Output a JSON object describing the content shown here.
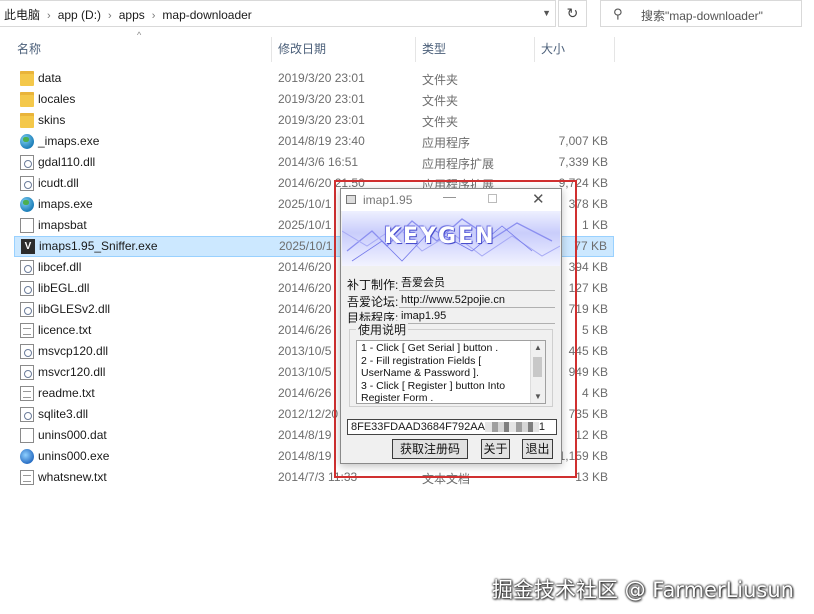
{
  "address_bar": {
    "crumbs": [
      "此电脑",
      "app (D:)",
      "apps",
      "map-downloader"
    ],
    "search_placeholder": "搜索\"map-downloader\""
  },
  "columns": {
    "name": "名称",
    "modified": "修改日期",
    "type": "类型",
    "size": "大小"
  },
  "files": [
    {
      "icon": "folder-icon",
      "name": "data",
      "date": "2019/3/20 23:01",
      "type": "文件夹",
      "size": ""
    },
    {
      "icon": "folder-icon",
      "name": "locales",
      "date": "2019/3/20 23:01",
      "type": "文件夹",
      "size": ""
    },
    {
      "icon": "folder-icon",
      "name": "skins",
      "date": "2019/3/20 23:01",
      "type": "文件夹",
      "size": ""
    },
    {
      "icon": "globe-app-icon",
      "name": "_imaps.exe",
      "date": "2014/8/19 23:40",
      "type": "应用程序",
      "size": "7,007 KB"
    },
    {
      "icon": "dll-file-icon",
      "name": "gdal110.dll",
      "date": "2014/3/6 16:51",
      "type": "应用程序扩展",
      "size": "7,339 KB"
    },
    {
      "icon": "dll-file-icon",
      "name": "icudt.dll",
      "date": "2014/6/20 21:50",
      "type": "应用程序扩展",
      "size": "9,724 KB"
    },
    {
      "icon": "globe-app-icon",
      "name": "imaps.exe",
      "date": "2025/10/1",
      "type": "",
      "size": "378 KB"
    },
    {
      "icon": "blank-file-icon",
      "name": "imapsbat",
      "date": "2025/10/1",
      "type": "",
      "size": "1 KB"
    },
    {
      "icon": "v-app-icon",
      "name": "imaps1.95_Sniffer.exe",
      "date": "2025/10/1",
      "type": "",
      "size": "77 KB"
    },
    {
      "icon": "dll-file-icon",
      "name": "libcef.dll",
      "date": "2014/6/20",
      "type": "",
      "size": "394 KB"
    },
    {
      "icon": "dll-file-icon",
      "name": "libEGL.dll",
      "date": "2014/6/20",
      "type": "",
      "size": "127 KB"
    },
    {
      "icon": "dll-file-icon",
      "name": "libGLESv2.dll",
      "date": "2014/6/20",
      "type": "",
      "size": "719 KB"
    },
    {
      "icon": "text-file-icon",
      "name": "licence.txt",
      "date": "2014/6/26",
      "type": "",
      "size": "5 KB"
    },
    {
      "icon": "dll-file-icon",
      "name": "msvcp120.dll",
      "date": "2013/10/5",
      "type": "",
      "size": "445 KB"
    },
    {
      "icon": "dll-file-icon",
      "name": "msvcr120.dll",
      "date": "2013/10/5",
      "type": "",
      "size": "949 KB"
    },
    {
      "icon": "text-file-icon",
      "name": "readme.txt",
      "date": "2014/6/26",
      "type": "",
      "size": "4 KB"
    },
    {
      "icon": "dll-file-icon",
      "name": "sqlite3.dll",
      "date": "2012/12/20",
      "type": "",
      "size": "735 KB"
    },
    {
      "icon": "blank-file-icon",
      "name": "unins000.dat",
      "date": "2014/8/19",
      "type": "",
      "size": "12 KB"
    },
    {
      "icon": "setup-app-icon",
      "name": "unins000.exe",
      "date": "2014/8/19",
      "type": "",
      "size": "1,159 KB"
    },
    {
      "icon": "text-file-icon",
      "name": "whatsnew.txt",
      "date": "2014/7/3 11:33",
      "type": "文本文档",
      "size": "13 KB"
    }
  ],
  "selected_index": 8,
  "keygen": {
    "title": "imap1.95",
    "banner": "KEYGEN",
    "labels": {
      "patcher": "补丁制作:",
      "forum": "吾爱论坛:",
      "target": "目标程序:"
    },
    "values": {
      "patcher": "吾爱会员",
      "forum": "http://www.52pojie.cn",
      "target": "imap1.95"
    },
    "instructions_title": "使用说明",
    "instructions": [
      "1 - Click [ Get Serial ] button .",
      "2 - Fill registration Fields [",
      "UserName & Password ].",
      "3 - Click [ Register ] button Into",
      "Register Form ."
    ],
    "serial_prefix": "8FE33FDAAD3684F792AA",
    "serial_suffix": "1",
    "buttons": {
      "get": "获取注册码",
      "about": "关于",
      "exit": "退出"
    }
  },
  "watermark": "掘金技术社区 @ FarmerLiusun",
  "colors": {
    "highlight": "#d03030",
    "selection": "#cce8ff",
    "header_text": "#4c607a"
  }
}
